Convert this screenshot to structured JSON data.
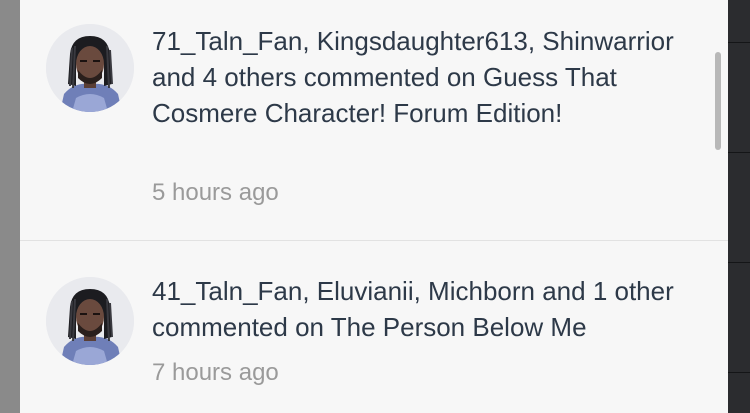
{
  "notifications": [
    {
      "text": "71_Taln_Fan, Kingsdaughter613, Shinwarrior and 4 others commented on Guess That Cosmere Character! Forum Edition!",
      "time": "5 hours ago"
    },
    {
      "text": "41_Taln_Fan, Eluvianii, Michborn and 1 other commented on The Person Below Me",
      "time": "7 hours ago"
    }
  ],
  "colors": {
    "panel_background": "#f7f7f7",
    "text_primary": "#2d3948",
    "text_secondary": "#9a9a9a",
    "divider": "#e2e2e2"
  },
  "icons": {
    "avatar": "character-portrait-avatar"
  }
}
